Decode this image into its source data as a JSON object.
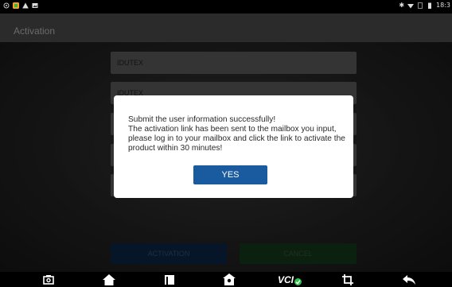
{
  "status_bar": {
    "left_icons": [
      "circle-status-icon",
      "app-notification-icon",
      "warning-triangle-icon",
      "image-notification-icon"
    ],
    "right_icons": [
      "bluetooth-icon",
      "wifi-icon",
      "sim-icon",
      "battery-icon"
    ],
    "time": "18:3"
  },
  "header": {
    "title": "Activation"
  },
  "form": {
    "fields": [
      {
        "value": "IDUTEX"
      },
      {
        "value": "IDUTEX"
      },
      {
        "value": ""
      },
      {
        "value": ""
      },
      {
        "value": ""
      }
    ]
  },
  "buttons": {
    "activation": "ACTIVATION",
    "cancel": "CANCEL"
  },
  "dialog": {
    "message": "Submit the user information successfully!\nThe activation link has been sent to the mailbox you input, please log in to your mailbox and click the link to activate the product within 30 minutes!",
    "yes_label": "YES"
  },
  "nav_bar": {
    "items": [
      "camera-icon",
      "home-icon",
      "window-icon",
      "shop-icon",
      "vci-icon",
      "crop-icon",
      "back-icon"
    ],
    "vci_label": "VCI"
  },
  "colors": {
    "dialog_button": "#1a5a9e",
    "activation_button": "#0c2748",
    "cancel_button": "#173b1e",
    "vci_check": "#2fbf4b"
  }
}
